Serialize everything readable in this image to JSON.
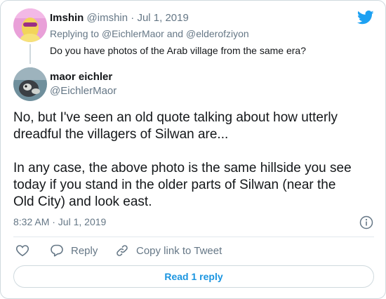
{
  "parent_tweet": {
    "author_name": "Imshin",
    "author_handle": "@imshin",
    "date": "Jul 1, 2019",
    "replying_prefix": "Replying to",
    "replying_to_1": "@EichlerMaor",
    "replying_and": "and",
    "replying_to_2": "@elderofziyon",
    "text": "Do you have photos of the Arab village from the same era?"
  },
  "main_tweet": {
    "author_name": "maor eichler",
    "author_handle": "@EichlerMaor",
    "paragraph_1_line_1": "No, but I've seen an old quote talking about how utterly",
    "paragraph_1_line_2": "dreadful the villagers of Silwan are...",
    "paragraph_2_line_1": "In any case, the above photo is the same hillside you see",
    "paragraph_2_line_2": "today if you stand in the older parts of Silwan (near the",
    "paragraph_2_line_3": "Old City) and look east.",
    "timestamp": "8:32 AM · Jul 1, 2019"
  },
  "actions": {
    "reply_label": "Reply",
    "copy_link_label": "Copy link to Tweet"
  },
  "read_replies_label": "Read 1 reply",
  "colors": {
    "brand_blue": "#1da1f2",
    "link_blue": "#1b95e0",
    "secondary_text": "#657786",
    "border": "#cfd9de"
  },
  "icons": [
    "twitter-logo-icon",
    "info-icon",
    "heart-icon",
    "reply-icon",
    "link-icon"
  ]
}
